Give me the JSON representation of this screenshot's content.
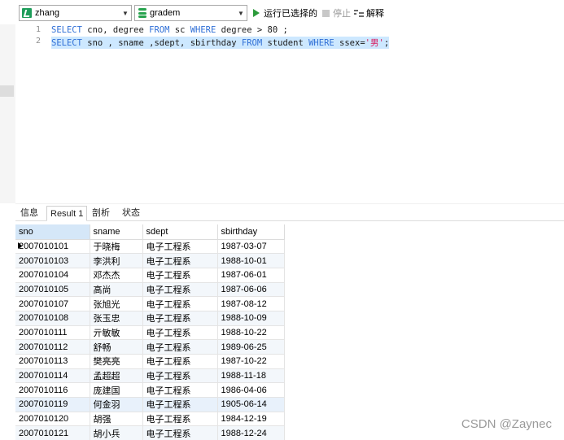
{
  "toolbar": {
    "connection": "zhang",
    "database": "gradem",
    "run_label": "运行已选择的",
    "stop_label": "停止",
    "explain_label": "解释"
  },
  "editor": {
    "lines": [
      {
        "no": "1",
        "tokens": [
          {
            "t": "SELECT",
            "k": "kw"
          },
          {
            "t": " cno, degree ",
            "k": "txt"
          },
          {
            "t": "FROM",
            "k": "kw"
          },
          {
            "t": " sc ",
            "k": "txt"
          },
          {
            "t": "WHERE",
            "k": "kw"
          },
          {
            "t": " degree > ",
            "k": "txt"
          },
          {
            "t": "80",
            "k": "num"
          },
          {
            "t": " ;",
            "k": "txt"
          }
        ]
      },
      {
        "no": "2",
        "tokens": [
          {
            "t": "SELECT",
            "k": "kw"
          },
          {
            "t": " sno , sname ,sdept, sbirthday ",
            "k": "txt"
          },
          {
            "t": "FROM",
            "k": "kw"
          },
          {
            "t": " student ",
            "k": "txt"
          },
          {
            "t": "WHERE",
            "k": "kw"
          },
          {
            "t": " ssex=",
            "k": "txt"
          },
          {
            "t": "'男'",
            "k": "str"
          },
          {
            "t": ";",
            "k": "txt"
          }
        ]
      }
    ]
  },
  "tabs": [
    "信息",
    "Result 1",
    "剖析",
    "状态"
  ],
  "active_tab": "Result 1",
  "grid": {
    "columns": [
      "sno",
      "sname",
      "sdept",
      "sbirthday"
    ],
    "rows": [
      [
        "2007010101",
        "于晓梅",
        "电子工程系",
        "1987-03-07"
      ],
      [
        "2007010103",
        "李洪利",
        "电子工程系",
        "1988-10-01"
      ],
      [
        "2007010104",
        "邓杰杰",
        "电子工程系",
        "1987-06-01"
      ],
      [
        "2007010105",
        "高尚",
        "电子工程系",
        "1987-06-06"
      ],
      [
        "2007010107",
        "张旭光",
        "电子工程系",
        "1987-08-12"
      ],
      [
        "2007010108",
        "张玉忠",
        "电子工程系",
        "1988-10-09"
      ],
      [
        "2007010111",
        "亓敏敏",
        "电子工程系",
        "1988-10-22"
      ],
      [
        "2007010112",
        "舒畅",
        "电子工程系",
        "1989-06-25"
      ],
      [
        "2007010113",
        "樊亮亮",
        "电子工程系",
        "1987-10-22"
      ],
      [
        "2007010114",
        "孟超超",
        "电子工程系",
        "1988-11-18"
      ],
      [
        "2007010116",
        "庞建国",
        "电子工程系",
        "1986-04-06"
      ],
      [
        "2007010119",
        "何金羽",
        "电子工程系",
        "1905-06-14"
      ],
      [
        "2007010120",
        "胡强",
        "电子工程系",
        "1984-12-19"
      ],
      [
        "2007010121",
        "胡小兵",
        "电子工程系",
        "1988-12-24"
      ]
    ],
    "selected_row": 11
  },
  "watermark": "CSDN @Zaynec",
  "colors": {
    "keyword": "#2f6fd6",
    "string": "#d81b60",
    "selection": "#cde8ff",
    "run_green": "#2b9a3a"
  }
}
